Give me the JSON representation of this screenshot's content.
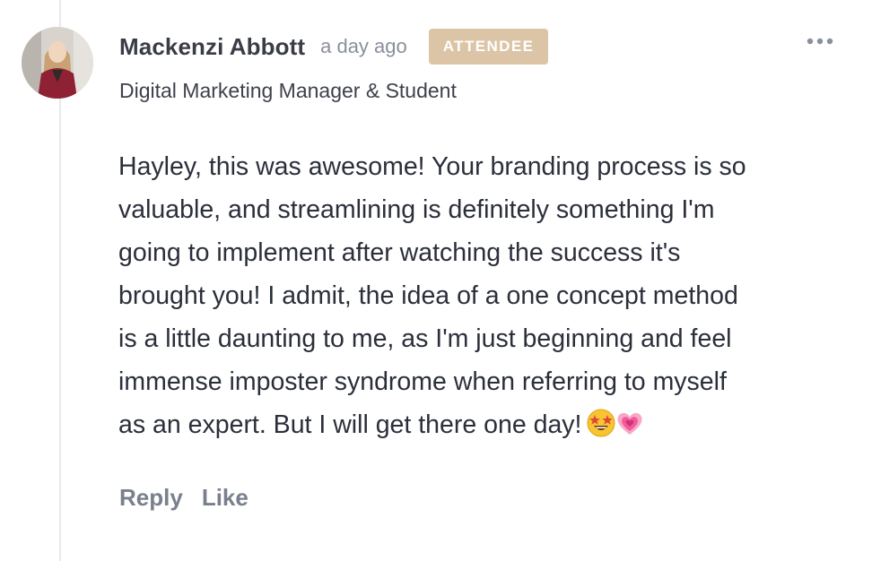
{
  "comment": {
    "author": {
      "name": "Mackenzi Abbott",
      "title": "Digital Marketing Manager & Student",
      "avatar_icon": "user-avatar-photo"
    },
    "timestamp": "a day ago",
    "badge": {
      "label": "ATTENDEE",
      "color": "#dcc5a6"
    },
    "menu_icon": "more-horizontal-icon",
    "body_lines": [
      "Hayley, this was awesome! Your branding process is so",
      "valuable, and streamlining is definitely something I'm",
      "going to implement after watching the success it's",
      "brought you! I admit, the idea of a one concept method",
      "is a little daunting to me, as I'm just beginning and feel",
      "immense imposter syndrome when referring to myself",
      "as an expert. But I will get there one day!"
    ],
    "emojis": [
      "star-struck-emoji",
      "growing-heart-emoji"
    ],
    "actions": {
      "reply_label": "Reply",
      "like_label": "Like"
    }
  },
  "colors": {
    "text_primary": "#2b2f3a",
    "text_muted": "#8a8f9c",
    "action_text": "#7a7f8e",
    "thread_line": "#e8e9ec"
  }
}
